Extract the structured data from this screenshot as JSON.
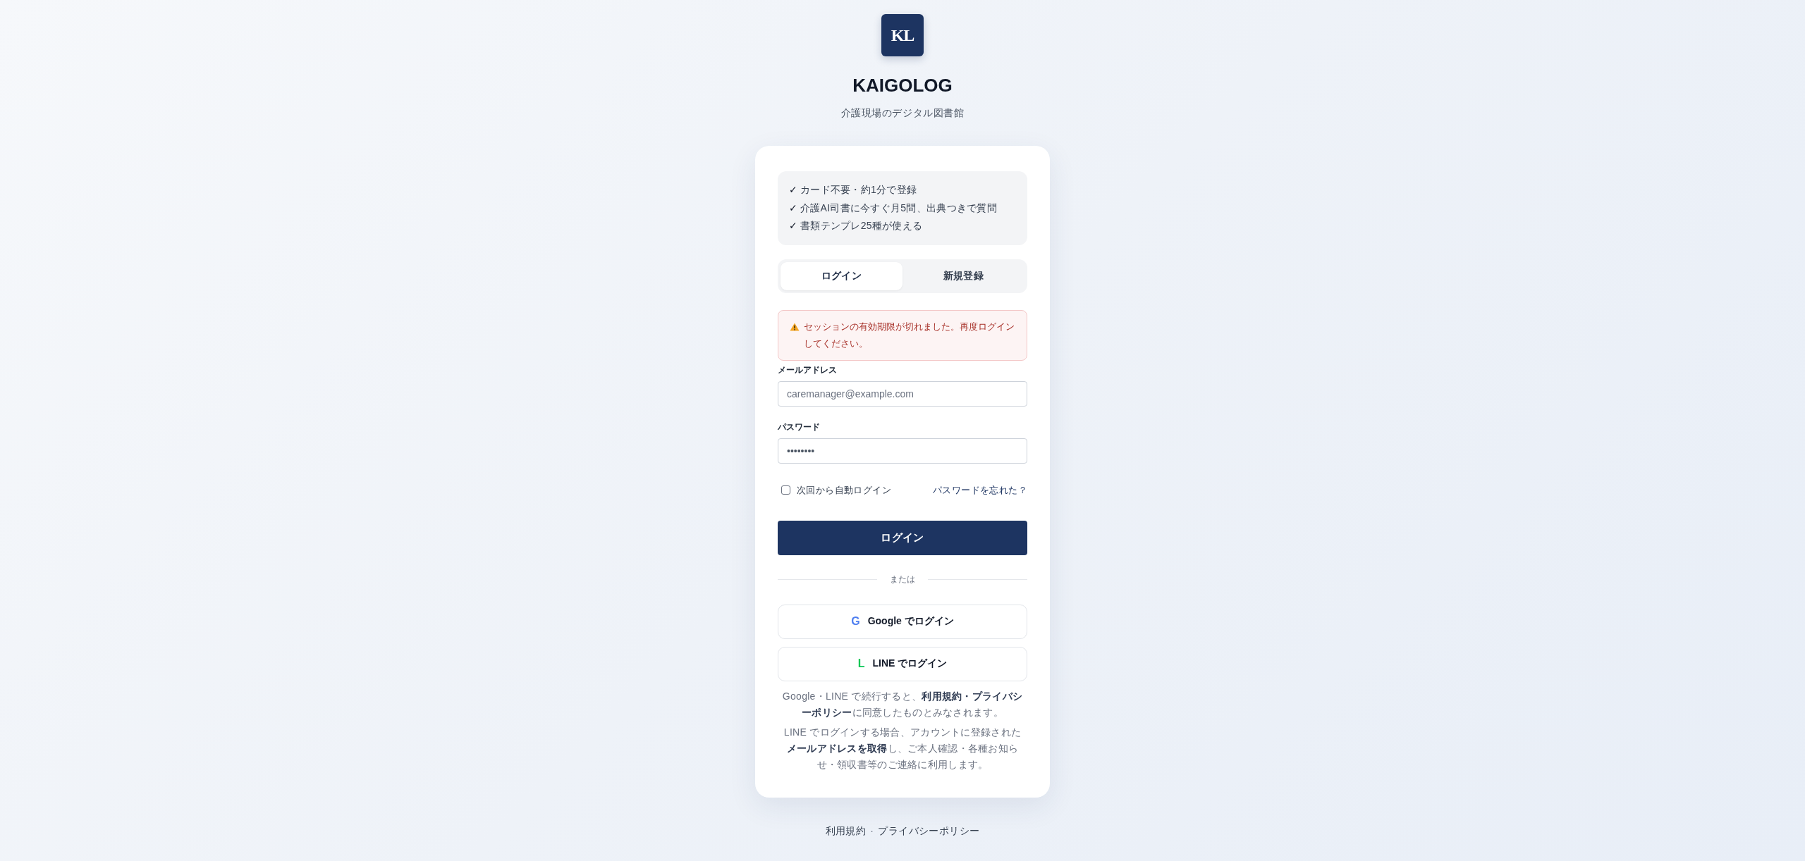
{
  "logo": {
    "text": "KL"
  },
  "brand": {
    "title": "KAIGOLOG",
    "subtitle": "介護現場のデジタル図書館"
  },
  "features": [
    {
      "mark": "✓",
      "text": "カード不要・約1分で登録"
    },
    {
      "mark": "✓",
      "text": "介護AI司書に今すぐ月5問、出典つきで質問"
    },
    {
      "mark": "✓",
      "text": "書類テンプレ25種が使える"
    }
  ],
  "tabs": [
    {
      "label": "ログイン",
      "selected": true
    },
    {
      "label": "新規登録",
      "selected": false
    }
  ],
  "alert": {
    "text": "セッションの有効期限が切れました。再度ログインしてください。"
  },
  "form": {
    "fields": [
      {
        "label": "メールアドレス",
        "placeholder": "caremanager@example.com"
      },
      {
        "label": "パスワード",
        "value": "••••••••"
      }
    ],
    "remember": {
      "label": "次回から自動ログイン",
      "checked": false
    },
    "forgot_link": "パスワードを忘れた？",
    "submit": "ログイン"
  },
  "divider": "または",
  "social_buttons": [
    {
      "kind": "google",
      "icon": "G",
      "label": "Google でログイン"
    },
    {
      "kind": "line",
      "icon": "L",
      "label": "LINE でログイン"
    }
  ],
  "notes": [
    "Google・LINE で続行すると、**利用規約・プライバシーポリシー**に同意したものとみなされます。",
    "LINE でログインする場合、アカウントに登録された**メールアドレスを取得**し、ご本人確認・各種お知らせ・領収書等のご連絡に利用します。"
  ],
  "footer": {
    "links": [
      "利用規約",
      "プライバシーポリシー"
    ],
    "separator": "·"
  }
}
